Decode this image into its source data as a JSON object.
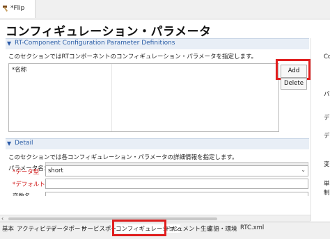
{
  "editor_tab": {
    "title": "*Flip",
    "icon": "hammer-icon"
  },
  "page": {
    "title": "コンフィギュレーション・パラメータ"
  },
  "section_params": {
    "title": "RT-Component Configuration Parameter Definitions",
    "description": "このセクションではRTコンポーネントのコンフィギュレーション・パラメータを指定します。",
    "column_name": "*名称",
    "add_button": "Add",
    "delete_button": "Delete"
  },
  "section_detail": {
    "title": "Detail",
    "description": "このセクションでは各コンフィギュレーション・パラメータの詳細情報を指定します。",
    "param_name_label": "パラメータ名：",
    "param_name_value": "",
    "datatype_label": "*データ型",
    "datatype_value": "short",
    "default_label": "*デフォルト値",
    "default_value": "",
    "var_label": "変数名"
  },
  "right_strip": {
    "labels": [
      "Co",
      "パラ",
      "デ",
      "デフ",
      "変",
      "単",
      "制"
    ]
  },
  "bottom_tabs": [
    {
      "label": "基本"
    },
    {
      "label": "アクティビティ"
    },
    {
      "label": "データポート"
    },
    {
      "label": "サービスポート"
    },
    {
      "label": "コンフィギュレーション"
    },
    {
      "label": "ドキュメント生成"
    },
    {
      "label": "言語・環境"
    },
    {
      "label": "RTC.xml"
    }
  ],
  "colors": {
    "highlight": "#e01e1e",
    "section_title": "#2b5ea7",
    "required_label": "#d01818"
  }
}
